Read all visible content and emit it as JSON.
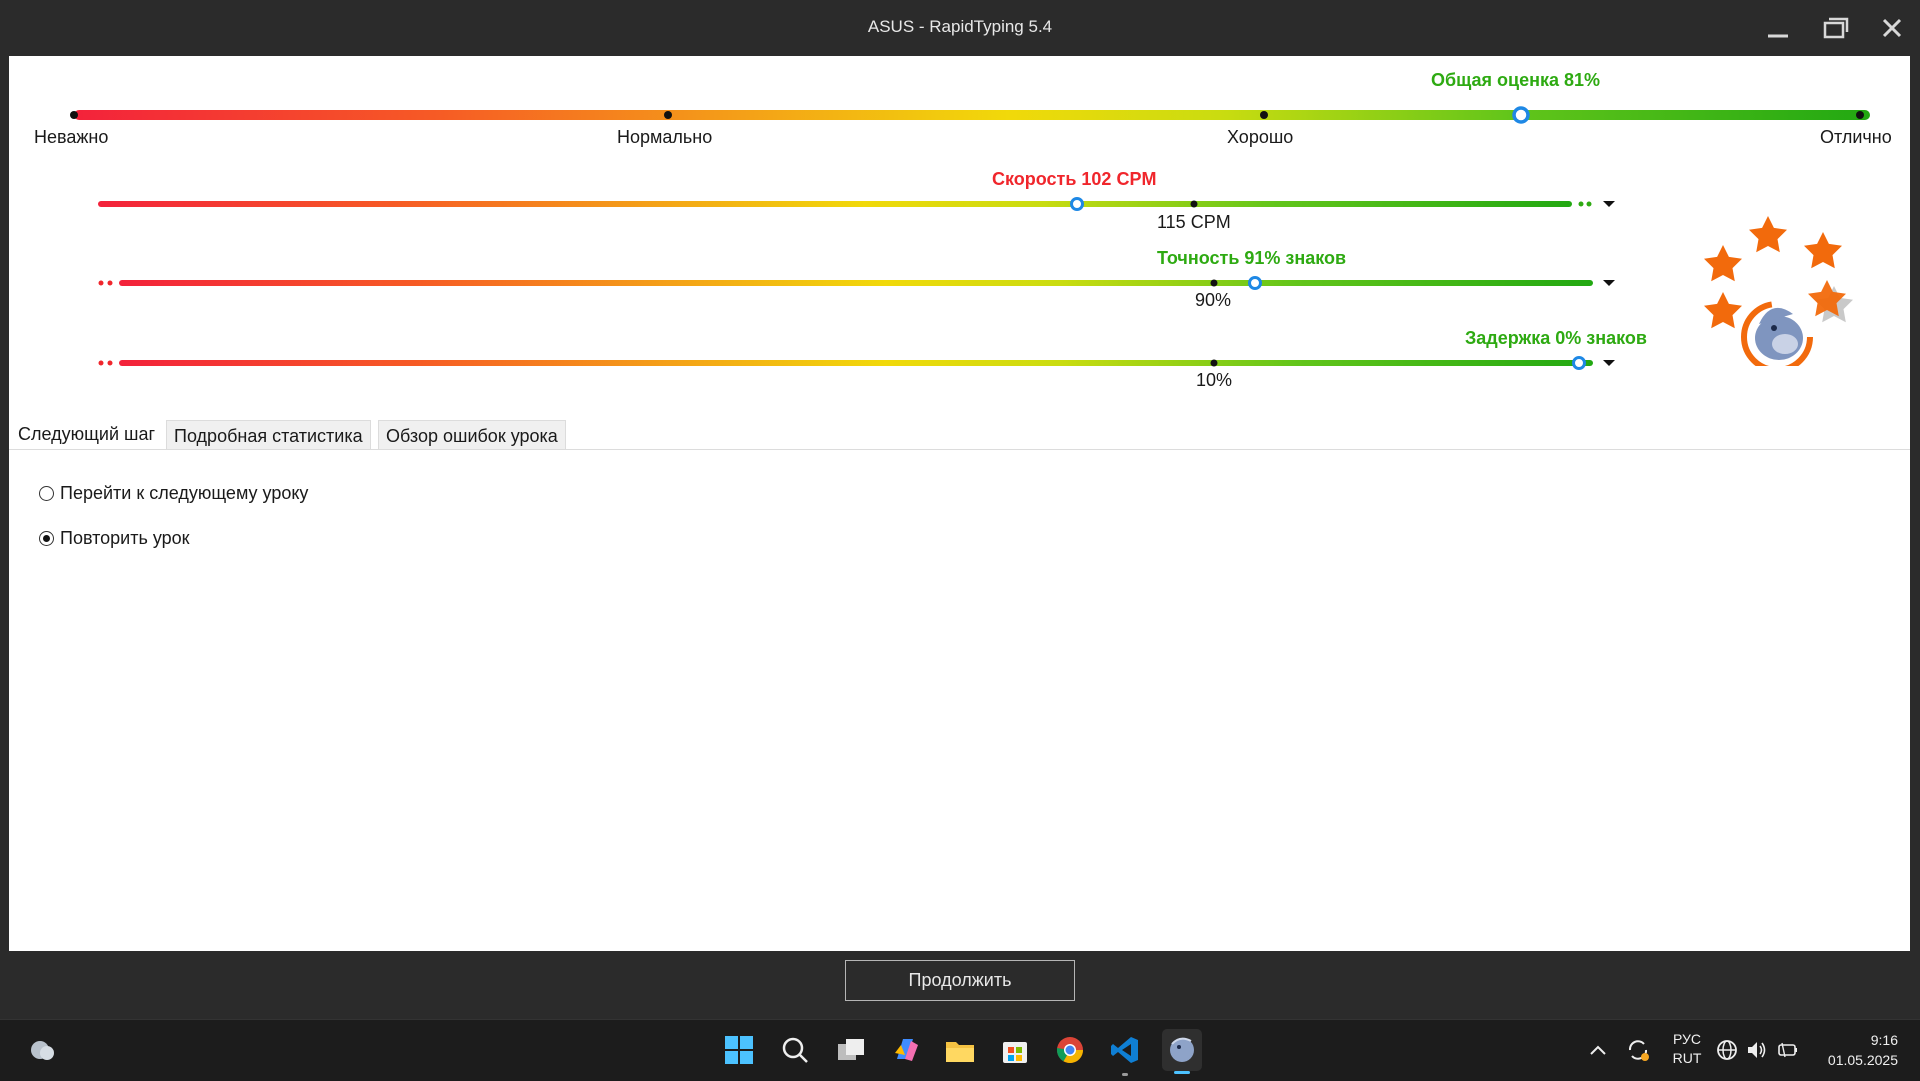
{
  "window": {
    "title": "ASUS - RapidTyping 5.4"
  },
  "overall": {
    "label": "Общая оценка 81%",
    "value_percent": 81,
    "scale": [
      "Неважно",
      "Нормально",
      "Хорошо",
      "Отлично"
    ]
  },
  "metrics": {
    "speed": {
      "label": "Скорость 102 CPM",
      "target": "115 CPM",
      "color": "#f0262c"
    },
    "accuracy": {
      "label": "Точность 91% знаков",
      "target": "90%",
      "color": "#2eaa12"
    },
    "delay": {
      "label": "Задержка 0% знаков",
      "target": "10%",
      "color": "#2eaa12"
    }
  },
  "tabs": [
    "Следующий шаг",
    "Подробная статистика",
    "Обзор ошибок урока"
  ],
  "next_step": {
    "options": [
      "Перейти к следующему уроку",
      "Повторить урок"
    ],
    "selected": "Повторить урок"
  },
  "continue_label": "Продолжить",
  "taskbar": {
    "lang_top": "РУС",
    "lang_bottom": "RUT",
    "time": "9:16",
    "date": "01.05.2025"
  },
  "rating_stars": 4,
  "colors": {
    "accent_green": "#2eaa12",
    "accent_red": "#f0262c",
    "marker_blue": "#1e88e5",
    "star_orange": "#f26a0c"
  }
}
